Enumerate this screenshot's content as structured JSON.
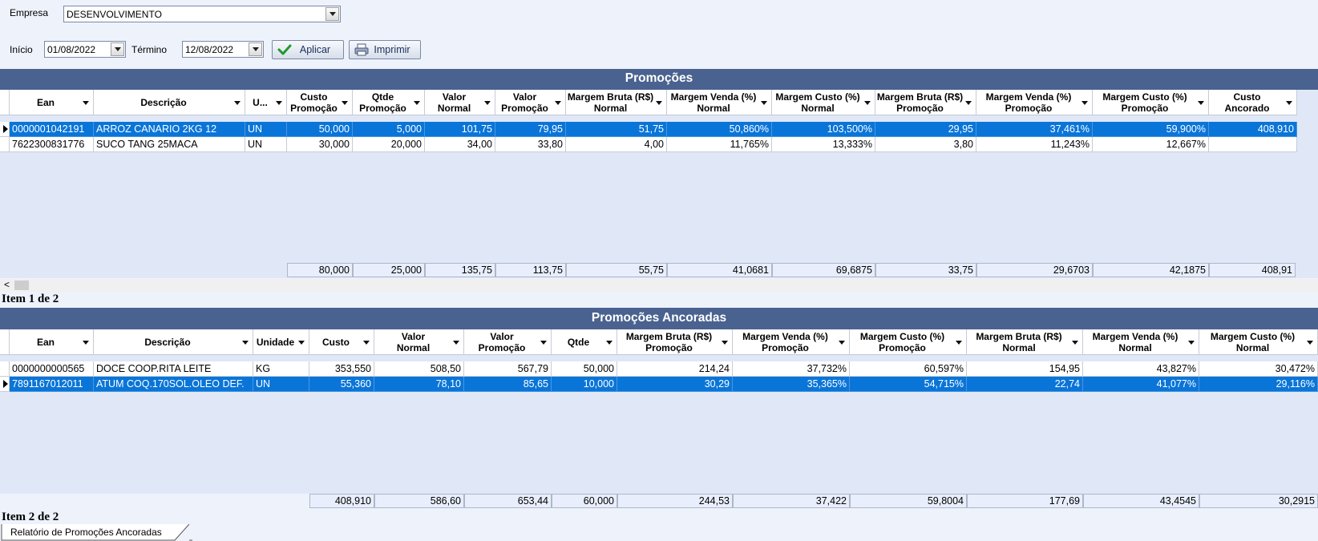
{
  "filters": {
    "empresa_label": "Empresa",
    "empresa_value": "DESENVOLVIMENTO",
    "inicio_label": "Início",
    "inicio_value": "01/08/2022",
    "termino_label": "Término",
    "termino_value": "12/08/2022",
    "aplicar_label": "Aplicar",
    "imprimir_label": "Imprimir"
  },
  "promocoes": {
    "title": "Promoções",
    "columns": [
      "Ean",
      "Descrição",
      "U...",
      "Custo Promoção",
      "Qtde Promoção",
      "Valor Normal",
      "Valor Promoção",
      "Margem Bruta (R$) Normal",
      "Margem Venda (%) Normal",
      "Margem Custo (%) Normal",
      "Margem Bruta (R$) Promoção",
      "Margem Venda (%) Promoção",
      "Margem Custo (%) Promoção",
      "Custo Ancorado"
    ],
    "columns_l1": [
      "Ean",
      "Descrição",
      "U...",
      "Custo",
      "Qtde",
      "Valor",
      "Valor",
      "Margem Bruta (R$)",
      "Margem Venda (%)",
      "Margem Custo (%)",
      "Margem Bruta (R$)",
      "Margem Venda (%)",
      "Margem Custo (%)",
      "Custo"
    ],
    "columns_l2": [
      "",
      "",
      "",
      "Promoção",
      "Promoção",
      "Normal",
      "Promoção",
      "Normal",
      "Normal",
      "Normal",
      "Promoção",
      "Promoção",
      "Promoção",
      "Ancorado"
    ],
    "rows": [
      [
        "0000001042191",
        "ARROZ CANARIO 2KG 12",
        "UN",
        "50,000",
        "5,000",
        "101,75",
        "79,95",
        "51,75",
        "50,860%",
        "103,500%",
        "29,95",
        "37,461%",
        "59,900%",
        "408,910"
      ],
      [
        "7622300831776",
        "SUCO TANG 25MACA",
        "UN",
        "30,000",
        "20,000",
        "34,00",
        "33,80",
        "4,00",
        "11,765%",
        "13,333%",
        "3,80",
        "11,243%",
        "12,667%",
        ""
      ]
    ],
    "selected_row": 0,
    "totals": [
      "80,000",
      "25,000",
      "135,75",
      "113,75",
      "55,75",
      "41,0681",
      "69,6875",
      "33,75",
      "29,6703",
      "42,1875",
      "408,91"
    ],
    "status": "Item 1 de 2"
  },
  "ancoradas": {
    "title": "Promoções Ancoradas",
    "columns_l1": [
      "Ean",
      "Descrição",
      "Unidade",
      "Custo",
      "Valor",
      "Valor",
      "Qtde",
      "Margem Bruta (R$)",
      "Margem Venda (%)",
      "Margem Custo (%)",
      "Margem Bruta (R$)",
      "Margem Venda (%)",
      "Margem Custo (%)"
    ],
    "columns_l2": [
      "",
      "",
      "",
      "",
      "Normal",
      "Promoção",
      "",
      "Promoção",
      "Promoção",
      "Promoção",
      "Normal",
      "Normal",
      "Normal"
    ],
    "rows": [
      [
        "0000000000565",
        "DOCE COOP.RITA LEITE",
        "KG",
        "353,550",
        "508,50",
        "567,79",
        "50,000",
        "214,24",
        "37,732%",
        "60,597%",
        "154,95",
        "43,827%",
        "30,472%"
      ],
      [
        "7891167012011",
        "ATUM COQ.170SOL.OLEO DEF.",
        "UN",
        "55,360",
        "78,10",
        "85,65",
        "10,000",
        "30,29",
        "35,365%",
        "54,715%",
        "22,74",
        "41,077%",
        "29,116%"
      ]
    ],
    "selected_row": 1,
    "totals": [
      "408,910",
      "586,60",
      "653,44",
      "60,000",
      "244,53",
      "37,422",
      "59,8004",
      "177,69",
      "43,4545",
      "30,2915"
    ],
    "status": "Item 2 de 2"
  },
  "tab": {
    "label": "Relatório de Promoções Ancoradas"
  },
  "colors": {
    "header_band": "#4a628f",
    "selection": "#0a75d8",
    "grid_bg": "#e0e8f8"
  },
  "icons": {
    "aplicar": "check-icon",
    "imprimir": "printer-icon"
  }
}
